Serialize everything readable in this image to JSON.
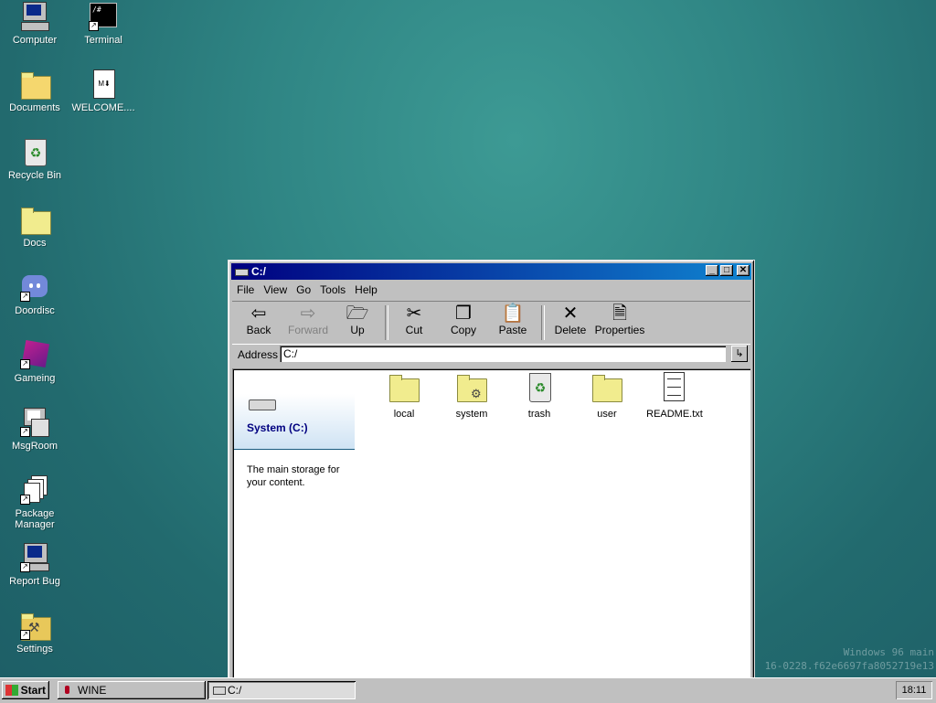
{
  "desktop": {
    "icons": [
      {
        "label": "Computer",
        "icon": "computer-icon"
      },
      {
        "label": "Terminal",
        "icon": "terminal-icon"
      },
      {
        "label": "Documents",
        "icon": "documents-folder-icon"
      },
      {
        "label": "WELCOME....",
        "icon": "markdown-file-icon"
      },
      {
        "label": "Recycle Bin",
        "icon": "recycle-bin-icon"
      },
      {
        "label": "Docs",
        "icon": "folder-icon"
      },
      {
        "label": "Doordisc",
        "icon": "doordisc-icon"
      },
      {
        "label": "Gameing",
        "icon": "game-cube-icon"
      },
      {
        "label": "MsgRoom",
        "icon": "msgroom-icon"
      },
      {
        "label": "Package Manager",
        "icon": "package-manager-icon"
      },
      {
        "label": "Report Bug",
        "icon": "report-bug-icon"
      },
      {
        "label": "Settings",
        "icon": "settings-icon"
      }
    ],
    "watermark_line1": "Windows 96 main",
    "watermark_line2": "16-0228.f62e6697fa8052719e13"
  },
  "window": {
    "title": "C:/",
    "menu": [
      "File",
      "View",
      "Go",
      "Tools",
      "Help"
    ],
    "toolbar": {
      "back": "Back",
      "forward": "Forward",
      "up": "Up",
      "cut": "Cut",
      "copy": "Copy",
      "paste": "Paste",
      "delete": "Delete",
      "properties": "Properties"
    },
    "address_label": "Address",
    "address_value": "C:/",
    "info": {
      "title": "System (C:)",
      "description": "The main storage for your content."
    },
    "files": [
      {
        "name": "local",
        "type": "folder"
      },
      {
        "name": "system",
        "type": "system-folder"
      },
      {
        "name": "trash",
        "type": "trash"
      },
      {
        "name": "user",
        "type": "folder"
      },
      {
        "name": "README.txt",
        "type": "text-file"
      }
    ]
  },
  "taskbar": {
    "start_label": "Start",
    "tasks": [
      "WINE",
      "C:/"
    ],
    "clock": "18:11"
  },
  "colors": {
    "desktop": "#2f8584",
    "title_start": "#000080",
    "title_end": "#1084d0",
    "folder": "#f1ec8e"
  }
}
